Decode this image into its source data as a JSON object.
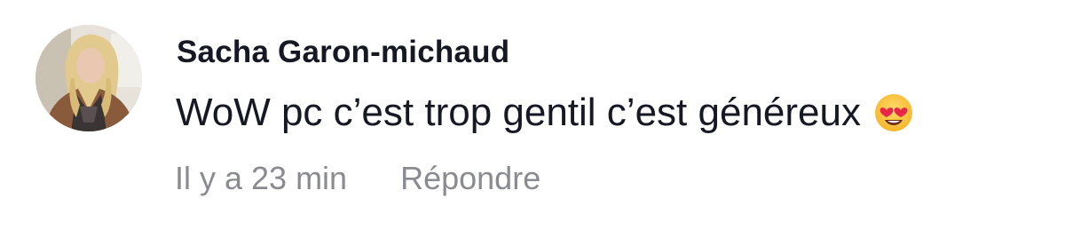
{
  "comment": {
    "author": "Sacha Garon-michaud",
    "text": "WoW pc c’est trop gentil c’est généreux",
    "emoji": "heart-eyes-emoji",
    "timestamp": "Il y a 23 min",
    "reply_label": "Répondre"
  },
  "colors": {
    "text_primary": "#161823",
    "text_secondary": "#8a8b91",
    "background": "#ffffff"
  }
}
